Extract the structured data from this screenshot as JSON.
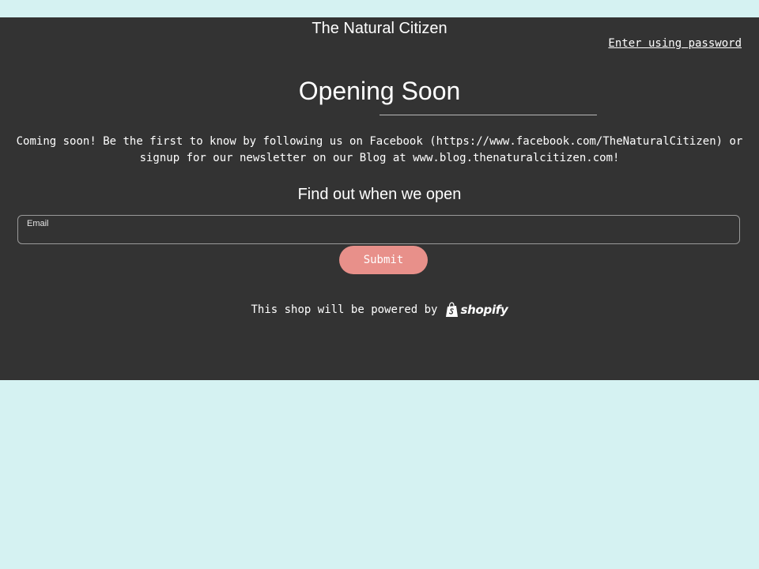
{
  "header": {
    "store_name": "The Natural Citizen",
    "password_link": "Enter using password"
  },
  "main": {
    "heading": "Opening Soon",
    "message": "Coming soon! Be the first to know by following us on Facebook (https://www.facebook.com/TheNaturalCitizen) or signup for our newsletter on our Blog at www.blog.thenaturalcitizen.com!",
    "subheading": "Find out when we open"
  },
  "form": {
    "email_label": "Email",
    "email_value": "",
    "submit_label": "Submit"
  },
  "footer": {
    "powered_text": "This shop will be powered by",
    "logo_icon": "shopify-bag-icon",
    "logo_text": "shopify"
  },
  "colors": {
    "page_background": "#d5f2f2",
    "panel_background": "#333333",
    "button_background": "#e8908a",
    "text": "#ffffff"
  }
}
